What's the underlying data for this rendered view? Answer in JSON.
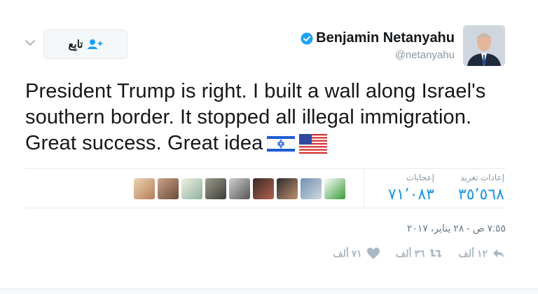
{
  "author": {
    "name": "Benjamin Netanyahu",
    "handle": "@netanyahu",
    "verified": true
  },
  "follow_button": {
    "label": "تابِع",
    "icon": "add-user-icon"
  },
  "menu_icon": "chevron-down-icon",
  "tweet": {
    "text": "President Trump is right. I built a wall along Israel's southern border. It stopped all illegal immigration. Great success. Great idea",
    "flags": [
      "israel-flag-icon",
      "us-flag-icon"
    ]
  },
  "stats": {
    "retweets": {
      "label": "إعادات تغريد",
      "value": "٣٥٬٥٦٨"
    },
    "likes": {
      "label": "إعجابات",
      "value": "٧١٬٠٨٣"
    }
  },
  "timestamp": "٧:٥٥ ص - ٢٨ يناير، ٢٠١٧",
  "actions": {
    "reply": {
      "icon": "reply-icon",
      "count": "١٢ ألف"
    },
    "retweet": {
      "icon": "retweet-icon",
      "count": "٣٦ ألف"
    },
    "like": {
      "icon": "heart-icon",
      "count": "٧١ ألف"
    }
  },
  "colors": {
    "accent": "#1b95e0",
    "muted": "#8899a6",
    "action_gray": "#aab8c2",
    "verified_blue": "#1da1f2"
  }
}
